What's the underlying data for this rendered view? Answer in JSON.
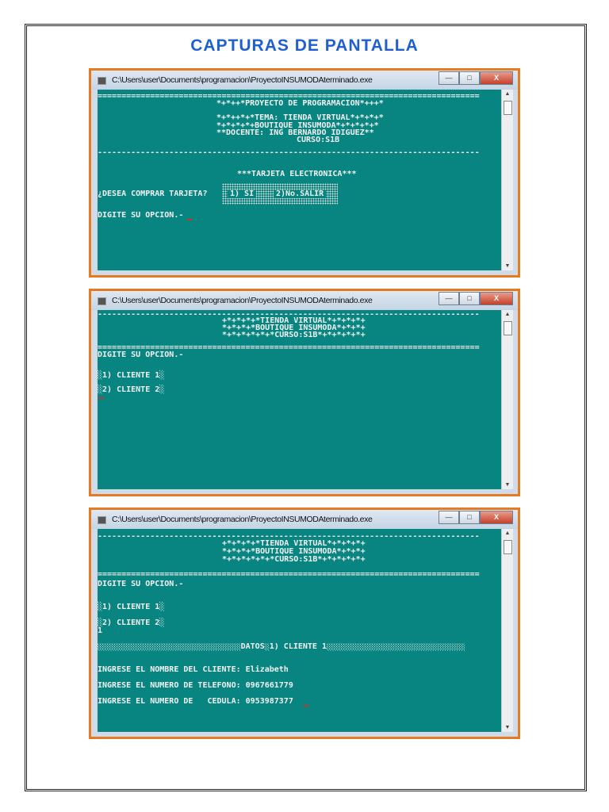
{
  "title": "CAPTURAS DE PANTALLA",
  "window_title": "C:\\Users\\user\\Documents\\programacion\\ProyectoINSUMODAterminado.exe",
  "buttons": {
    "minimize": "—",
    "maximize": "□",
    "close": "X"
  },
  "rules": {
    "eq": "================================================================================",
    "dash": "--------------------------------------------------------------------------------"
  },
  "shot1": {
    "l1": "*+*++*PROYECTO DE PROGRAMACION*+++*",
    "l2": "*+*++*+*TEMA: TIENDA VIRTUAL*+*+*+*",
    "l3": "*+*+*+*+BOUTIQUE INSUMODA*+*+*+*+*",
    "l4": "**DOCENTE: ING BERNARDO IDIGUEZ**",
    "l5": "CURSO:S1B",
    "l6": "***TARJETA ELECTRONICA***",
    "q": "¿DESEA COMPRAR TARJETA?",
    "opt1": "1) SI",
    "opt2": "2)No.SALIR",
    "prompt": "DIGITE SU OPCION.-"
  },
  "shot2": {
    "l1": "+*+*+*+*TIENDA VIRTUAL*+*+*+*+",
    "l2": "*+*+*+*BOUTIQUE INSUMODA*+*+*+",
    "l3": "*+*+*+*+*+*CURSO:S1B*+*+*+*+*+",
    "prompt": "DIGITE SU OPCION.-",
    "c1": "░1) CLIENTE 1░",
    "c2": "░2) CLIENTE 2░"
  },
  "shot3": {
    "l1": "+*+*+*+*TIENDA VIRTUAL*+*+*+*+",
    "l2": "*+*+*+*BOUTIQUE INSUMODA*+*+*+",
    "l3": "*+*+*+*+*+*CURSO:S1B*+*+*+*+*+",
    "prompt": "DIGITE SU OPCION.-",
    "c1": "░1) CLIENTE 1░",
    "c2": "░2) CLIENTE 2░",
    "input": "1",
    "datos": "░░░░░░░░░░░░░░░░░░░░░░░░░░░░░░DATOS░1) CLIENTE 1░░░░░░░░░░░░░░░░░░░░░░░░░░░░░",
    "nombre": "INGRESE EL NOMBRE DEL CLIENTE: Elizabeth",
    "telefono": "INGRESE EL NUMERO DE TELEFONO: 0967661779",
    "cedula": "INGRESE EL NUMERO DE   CEDULA: 0953987377"
  }
}
